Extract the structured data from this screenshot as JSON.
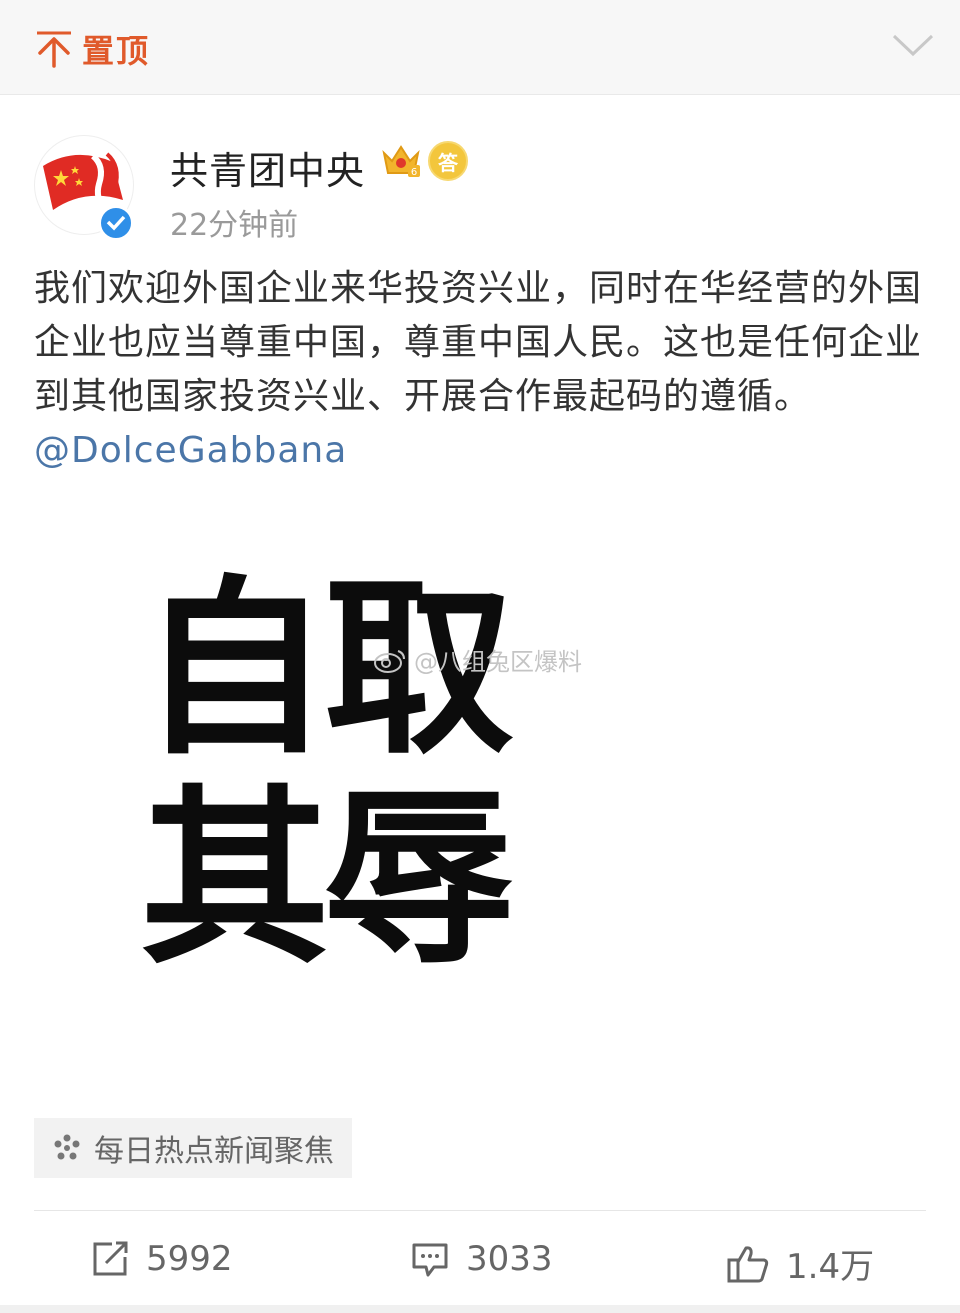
{
  "topbar": {
    "pin_label": "置顶",
    "pin_icon": "pin-top-icon",
    "collapse_icon": "chevron-down-icon",
    "accent": "#e05a2b"
  },
  "post": {
    "author": "共青团中央",
    "time": "22分钟前",
    "badges": [
      "crown-vip-icon",
      "answer-badge-icon",
      "verified-icon"
    ],
    "answer_badge_text": "答",
    "text": "我们欢迎外国企业来华投资兴业，同时在华经营的外国企业也应当尊重中国，尊重中国人民。这也是任何企业到其他国家投资兴业、开展合作最起码的遵循。",
    "mention": "@DolceGabbana",
    "mention_color": "#4b76a8",
    "image_text": [
      "自取",
      "其辱"
    ],
    "watermark": "@八组兔区爆料",
    "topic": "每日热点新闻聚焦"
  },
  "actions": {
    "repost_count": "5992",
    "comment_count": "3033",
    "like_count": "1.4万"
  }
}
